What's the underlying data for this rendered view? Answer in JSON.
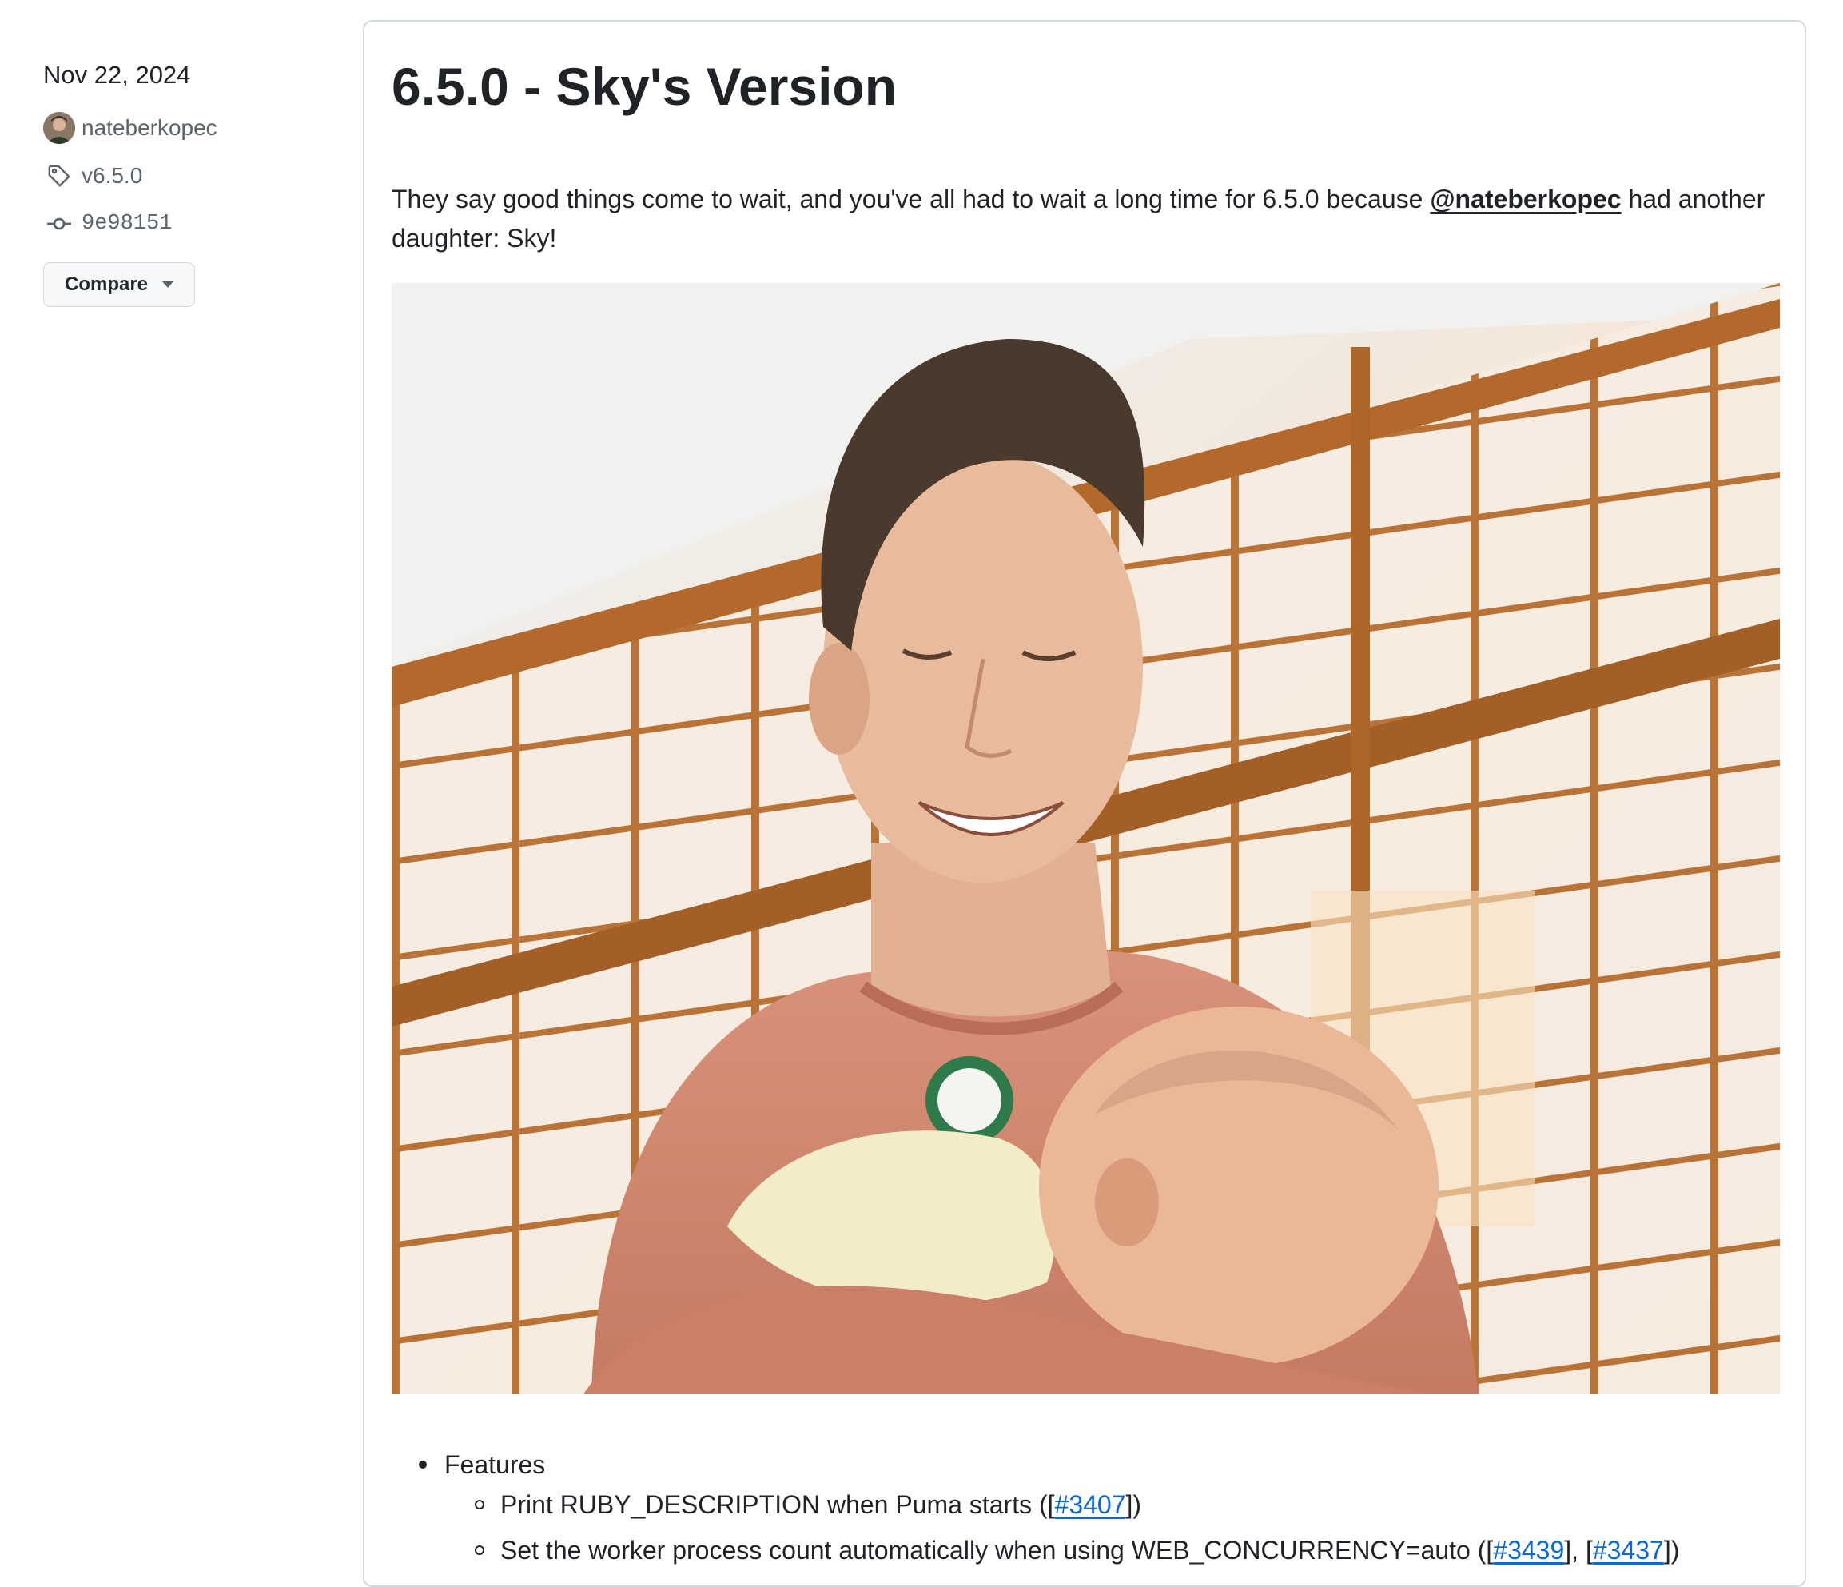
{
  "sidebar": {
    "date": "Nov 22, 2024",
    "author": "nateberkopec",
    "tag": "v6.5.0",
    "commit": "9e98151",
    "compare_label": "Compare"
  },
  "release": {
    "title": "6.5.0 - Sky's Version",
    "intro_before": "They say good things come to wait, and you've all had to wait a long time for 6.5.0 because ",
    "intro_mention": "@nateberkopec",
    "intro_after": " had another daughter: Sky!",
    "features_label": "Features",
    "features": [
      {
        "text": "Print RUBY_DESCRIPTION when Puma starts (",
        "refs": [
          "#3407"
        ],
        "suffix": ")"
      },
      {
        "text": "Set the worker process count automatically when using WEB_CONCURRENCY=auto (",
        "refs": [
          "#3439",
          "#3437"
        ],
        "suffix": ")"
      }
    ]
  },
  "colors": {
    "link": "#0969da",
    "text": "#1f2328",
    "muted": "#59636e",
    "border": "#d1d9e0"
  }
}
